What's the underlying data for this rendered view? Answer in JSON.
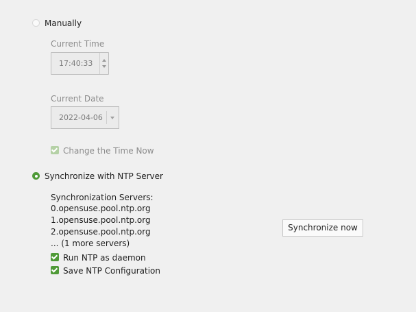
{
  "manual": {
    "label": "Manually",
    "current_time_label": "Current Time",
    "time_value": "17:40:33",
    "current_date_label": "Current Date",
    "date_value": "2022-04-06",
    "change_time_label": "Change the Time Now",
    "change_time_checked": true
  },
  "ntp": {
    "label": "Synchronize with NTP Server",
    "selected": true,
    "servers_heading": "Synchronization Servers:",
    "servers": [
      "0.opensuse.pool.ntp.org",
      "1.opensuse.pool.ntp.org",
      "2.opensuse.pool.ntp.org"
    ],
    "more_servers": "... (1 more servers)",
    "run_daemon_label": "Run NTP as daemon",
    "save_config_label": "Save NTP Configuration",
    "sync_button_label": "Synchronize now"
  },
  "colors": {
    "accent": "#4f9a37",
    "background": "#f0f0f0"
  }
}
